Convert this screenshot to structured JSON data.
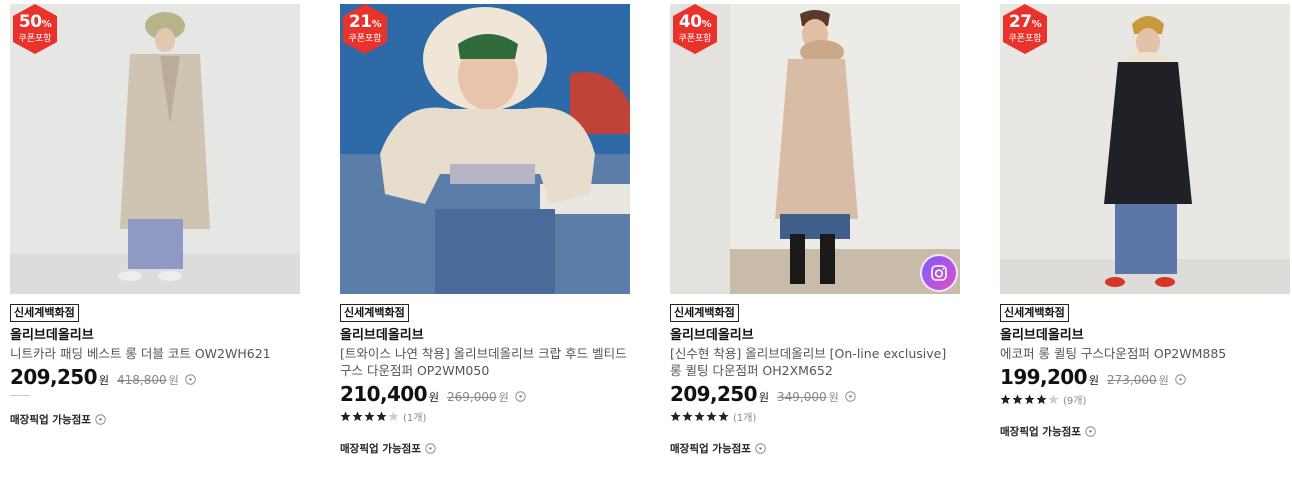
{
  "products": [
    {
      "discount": "50",
      "discount_unit": "%",
      "coupon_label": "쿠폰포함",
      "store_tag": "신세계백화점",
      "brand": "올리브데올리브",
      "name": "니트카라 패딩 베스트 롱 더블 코트 OW2WH621",
      "price": "209,250",
      "currency": "원",
      "original_price": "418,800",
      "original_currency": "원",
      "pickup_label": "매장픽업 가능점포"
    },
    {
      "discount": "21",
      "discount_unit": "%",
      "coupon_label": "쿠폰포함",
      "store_tag": "신세계백화점",
      "brand": "올리브데올리브",
      "name": "[트와이스 나연 착용] 올리브데올리브 크랍 후드 벨티드 구스 다운점퍼 OP2WM050",
      "price": "210,400",
      "currency": "원",
      "original_price": "269,000",
      "original_currency": "원",
      "rating": 4,
      "review_count": "(1개)",
      "pickup_label": "매장픽업 가능점포"
    },
    {
      "discount": "40",
      "discount_unit": "%",
      "coupon_label": "쿠폰포함",
      "store_tag": "신세계백화점",
      "brand": "올리브데올리브",
      "name": "[신수현 착용] 올리브데올리브 [On-line exclusive] 롱 퀼팅 다운점퍼 OH2XM652",
      "price": "209,250",
      "currency": "원",
      "original_price": "349,000",
      "original_currency": "원",
      "rating": 5,
      "review_count": "(1개)",
      "pickup_label": "매장픽업 가능점포"
    },
    {
      "discount": "27",
      "discount_unit": "%",
      "coupon_label": "쿠폰포함",
      "store_tag": "신세계백화점",
      "brand": "올리브데올리브",
      "name": "에코퍼 롱 퀼팅 구스다운점퍼 OP2WM885",
      "price": "199,200",
      "currency": "원",
      "original_price": "273,000",
      "original_currency": "원",
      "rating": 4,
      "review_count": "(9개)",
      "pickup_label": "매장픽업 가능점포"
    }
  ],
  "icons": {
    "badge": "hexagon-badge-icon",
    "info": "circle-chevron-down-icon",
    "camera": "camera-review-icon",
    "star": "star-icon"
  },
  "colors": {
    "badge_red": "#e8322b",
    "star_filled": "#222222",
    "star_empty": "#cfcfcf",
    "strike_gray": "#888888"
  }
}
